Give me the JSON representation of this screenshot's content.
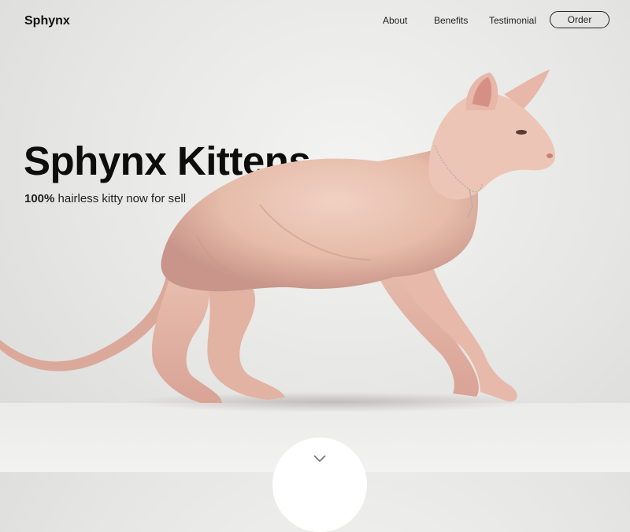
{
  "brand": {
    "name": "Sphynx"
  },
  "nav": {
    "items": [
      {
        "label": "About"
      },
      {
        "label": "Benefits"
      },
      {
        "label": "Testimonial"
      }
    ],
    "order_label": "Order"
  },
  "hero": {
    "title": "Sphynx Kittens",
    "subtitle_bold": "100%",
    "subtitle_rest": " hairless kitty now for sell"
  },
  "image": {
    "subject": "sphynx-cat-icon"
  },
  "scroll": {
    "icon": "chevron-down-icon"
  },
  "colors": {
    "text": "#111111",
    "background": "#e8e8e6",
    "cat_skin": "#e9c2b4"
  }
}
